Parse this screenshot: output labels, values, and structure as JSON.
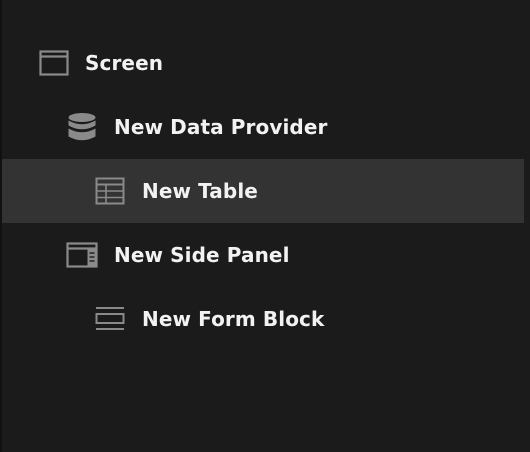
{
  "tree": {
    "items": [
      {
        "label": "Screen",
        "icon": "screen-icon",
        "depth": 0,
        "selected": false
      },
      {
        "label": "New Data Provider",
        "icon": "database-icon",
        "depth": 1,
        "selected": false
      },
      {
        "label": "New Table",
        "icon": "table-icon",
        "depth": 2,
        "selected": true
      },
      {
        "label": "New Side Panel",
        "icon": "side-panel-icon",
        "depth": 1,
        "selected": false
      },
      {
        "label": "New Form Block",
        "icon": "form-block-icon",
        "depth": 2,
        "selected": false
      }
    ]
  },
  "colors": {
    "background": "#1b1b1c",
    "selected_row": "#333334",
    "text": "#f2f2f2",
    "icon": "#8a8a8a"
  }
}
